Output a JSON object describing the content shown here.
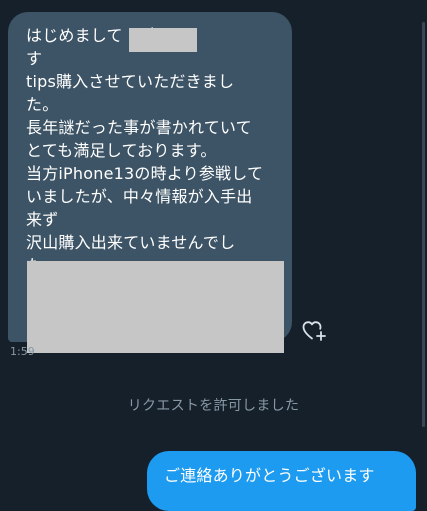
{
  "received_message": {
    "lines": [
      "はじめまして        と申しま",
      "す",
      "tips購入させていただきまし",
      "た。",
      "長年謎だった事が書かれていて",
      "とても満足しております。",
      "当方iPhone13の時より参戦して",
      "いましたが、中々情報が入手出",
      "来ず",
      "沢山購入出来ていませんでし",
      "た。"
    ],
    "timestamp": "1:59",
    "react_icon": "heart-plus-icon"
  },
  "notice": "リクエストを許可しました",
  "sent_message": {
    "text": "ご連絡ありがとうございます"
  },
  "colors": {
    "background": "#15202b",
    "received_bubble": "#3d5466",
    "sent_bubble": "#1d9bf0",
    "redaction": "#c6c6c6",
    "muted_text": "#8899a6"
  }
}
